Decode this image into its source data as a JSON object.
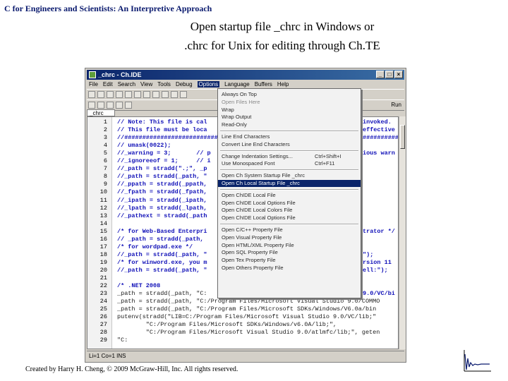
{
  "slide": {
    "header": "C for Engineers and Scientists: An Interpretive Approach",
    "title_line1": "Open startup file _chrc in Windows  or",
    "title_line2": ".chrc for Unix for editing through Ch.TE",
    "footer": "Created by Harry H. Cheng, © 2009 McGraw-Hill, Inc.  All rights reserved."
  },
  "window": {
    "title": "_chrc - Ch.IDE",
    "menus": [
      "File",
      "Edit",
      "Search",
      "View",
      "Tools",
      "Debug",
      "Options",
      "Language",
      "Buffers",
      "Help"
    ],
    "active_menu_index": 6,
    "toolbar2_right": "Run",
    "tab": "_chrc",
    "status": "Li=1 Co=1 INS",
    "accent": "#0a246a"
  },
  "editor": {
    "line_numbers": [
      "1",
      "2",
      "3",
      "4",
      "5",
      "6",
      "7",
      "8",
      "9",
      "10",
      "11",
      "12",
      "13",
      "14",
      "15",
      "16",
      "17",
      "18",
      "19",
      "20",
      "21",
      "22",
      "23",
      "24",
      "25",
      "26",
      "27",
      "28",
      "29"
    ],
    "lines": [
      "// Note: This file is cal",
      "// This file must be loca",
      "//##########################",
      "// umask(0022);",
      "//_warning = 3;       // p",
      "//_ignoreeof = 1;     // i",
      "//_path = stradd(\".;\", _p",
      "//_path = stradd(_path, \"",
      "//_ppath = stradd(_ppath,",
      "//_fpath = stradd(_fpath,",
      "//_ipath = stradd(_ipath,",
      "//_lpath = stradd(_lpath,",
      "//_pathext = stradd(_path",
      "",
      "/* for Web-Based Enterpri",
      "// _path = stradd(_path,",
      "/* for wordpad.exe */",
      "//_path = stradd(_path, \"",
      "/* for winword.exe, you m",
      "//_path = stradd(_path, \"",
      "",
      "/* .NET 2008",
      "_path = stradd(_path, \"C:",
      "_path = stradd(_path, \"C:/Program Files/Microsoft Visual Studio 9.0/COMMO",
      "_path = stradd(_path, \"C:/Program Files/Microsoft SDKs/Windows/V6.0a/bin",
      "putenv(stradd(\"LIB=C:/Program Files/Microsoft Visual Studio 9.0/VC/lib;\"",
      "        \"C:/Program Files/Microsoft SDKs/Windows/v6.0A/lib;\",",
      "        \"C:/Program Files/Microsoft Visual Studio 9.0/atlmfc/lib;\", geten",
      "\"C:"
    ],
    "right_fragments": [
      {
        "line": 1,
        "text": "invoked."
      },
      {
        "line": 2,
        "text": "effective"
      },
      {
        "line": 3,
        "text": "##########"
      },
      {
        "line": 5,
        "text": "ious warn"
      },
      {
        "line": 15,
        "text": "trator */"
      },
      {
        "line": 18,
        "text": "\");"
      },
      {
        "line": 19,
        "text": "rsion 11"
      },
      {
        "line": 20,
        "text": "ell:\");"
      },
      {
        "line": 23,
        "text": "9.0/VC/bi"
      }
    ]
  },
  "options_menu": [
    {
      "label": "Always On Top",
      "shortcut": "",
      "state": "normal"
    },
    {
      "label": "Open Files Here",
      "shortcut": "",
      "state": "dim"
    },
    {
      "label": "Wrap",
      "shortcut": "",
      "state": "normal"
    },
    {
      "label": "Wrap Output",
      "shortcut": "",
      "state": "normal"
    },
    {
      "label": "Read-Only",
      "shortcut": "",
      "state": "normal"
    },
    {
      "sep": true
    },
    {
      "label": "Line End Characters",
      "shortcut": "",
      "state": "normal"
    },
    {
      "label": "Convert Line End Characters",
      "shortcut": "",
      "state": "normal"
    },
    {
      "sep": true
    },
    {
      "label": "Change Indentation Settings...",
      "shortcut": "Ctrl+Shift+I",
      "state": "normal"
    },
    {
      "label": "Use Monospaced Font",
      "shortcut": "Ctrl+F11",
      "state": "normal"
    },
    {
      "sep": true
    },
    {
      "label": "Open Ch System Startup File _chrc",
      "shortcut": "",
      "state": "normal"
    },
    {
      "label": "Open Ch Local Startup File _chrc",
      "shortcut": "",
      "state": "highlight"
    },
    {
      "sep": true
    },
    {
      "label": "Open ChIDE Local File",
      "shortcut": "",
      "state": "normal"
    },
    {
      "label": "Open ChIDE Local Options File",
      "shortcut": "",
      "state": "normal"
    },
    {
      "label": "Open ChIDE Local Colors File",
      "shortcut": "",
      "state": "normal"
    },
    {
      "label": "Open ChIDE Local Options File",
      "shortcut": "",
      "state": "normal"
    },
    {
      "sep": true
    },
    {
      "label": "Open C/C++ Property File",
      "shortcut": "",
      "state": "normal"
    },
    {
      "label": "Open Visual Property File",
      "shortcut": "",
      "state": "normal"
    },
    {
      "label": "Open HTML/XML Property File",
      "shortcut": "",
      "state": "normal"
    },
    {
      "label": "Open SQL Property File",
      "shortcut": "",
      "state": "normal"
    },
    {
      "label": "Open Tex Property File",
      "shortcut": "",
      "state": "normal"
    },
    {
      "label": "Open Others Property File",
      "shortcut": "",
      "state": "normal"
    }
  ]
}
